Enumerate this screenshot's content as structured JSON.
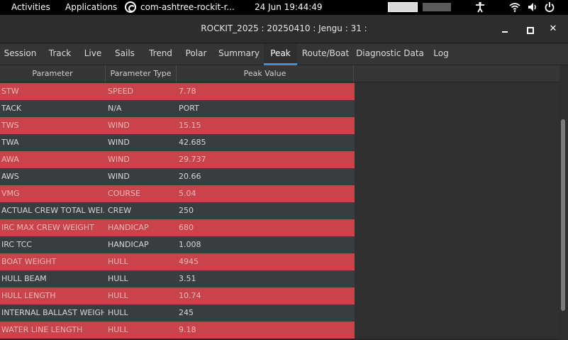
{
  "topbar": {
    "activities": "Activities",
    "applications": "Applications",
    "app_name": "com-ashtree-rockit-r...",
    "clock": "24 Jun  19:44:49",
    "icons": [
      "accessibility-icon",
      "wifi-icon",
      "volume-icon",
      "power-icon"
    ]
  },
  "window": {
    "title": "ROCKIT_2025 : 20250410 : Jengu : 31 :",
    "close_glyph": "✕"
  },
  "tabs": [
    "Session",
    "Track",
    "Live",
    "Sails",
    "Trend",
    "Polar",
    "Summary",
    "Peak",
    "Route/Boat",
    "Diagnostic Data",
    "Log"
  ],
  "active_tab": "Peak",
  "table": {
    "columns": [
      "Parameter",
      "Parameter Type",
      "Peak Value"
    ],
    "rows": [
      {
        "parameter": "STW",
        "type": "SPEED",
        "value": "7.78"
      },
      {
        "parameter": "TACK",
        "type": "N/A",
        "value": "PORT"
      },
      {
        "parameter": "TWS",
        "type": "WIND",
        "value": "15.15"
      },
      {
        "parameter": "TWA",
        "type": "WIND",
        "value": "42.685"
      },
      {
        "parameter": "AWA",
        "type": "WIND",
        "value": "29.737"
      },
      {
        "parameter": "AWS",
        "type": "WIND",
        "value": "20.66"
      },
      {
        "parameter": "VMG",
        "type": "COURSE",
        "value": "5.04"
      },
      {
        "parameter": "ACTUAL CREW TOTAL WEI...",
        "type": "CREW",
        "value": "250"
      },
      {
        "parameter": "IRC MAX CREW WEIGHT",
        "type": "HANDICAP",
        "value": "680"
      },
      {
        "parameter": "IRC TCC",
        "type": "HANDICAP",
        "value": "1.008"
      },
      {
        "parameter": "BOAT WEIGHT",
        "type": "HULL",
        "value": "4945"
      },
      {
        "parameter": "HULL BEAM",
        "type": "HULL",
        "value": "3.51"
      },
      {
        "parameter": "HULL LENGTH",
        "type": "HULL",
        "value": "10.74"
      },
      {
        "parameter": "INTERNAL BALLAST WEIGHT",
        "type": "HULL",
        "value": "245"
      },
      {
        "parameter": "WATER LINE LENGTH",
        "type": "HULL",
        "value": "9.18"
      }
    ]
  },
  "colors": {
    "row_highlight": "#c9444a",
    "row_normal": "#3a3d40",
    "active_tab_accent": "#3d8fd6"
  }
}
